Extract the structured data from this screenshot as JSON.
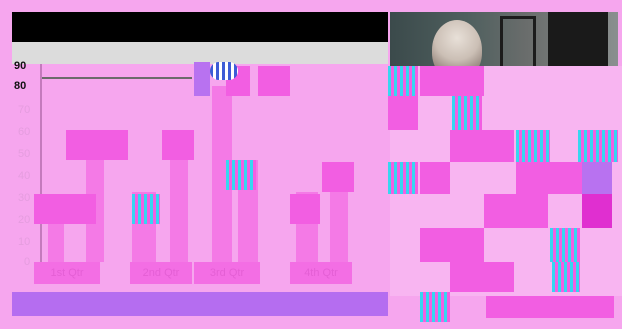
{
  "chart": {
    "y_ticks": [
      "90",
      "80"
    ],
    "y_ticks_faded": [
      "70",
      "60",
      "50",
      "40",
      "30",
      "20",
      "10",
      "0"
    ],
    "categories": [
      "1st Qtr",
      "2nd Qtr",
      "3rd Qtr",
      "4th Qtr"
    ]
  },
  "icons": {
    "video_thumbnail": "presenter-video-icon",
    "slider_marker": "slider-thumb-icon"
  },
  "colors": {
    "background": "#f6a6ee",
    "glitch_magenta": "#f25ee2",
    "glitch_cyan": "#36d6f0",
    "scrollbar": "#b56df0"
  }
}
